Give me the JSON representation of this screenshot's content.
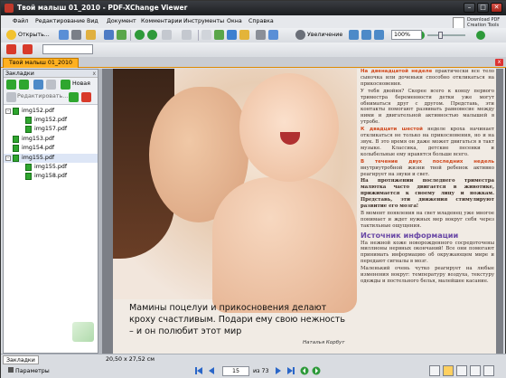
{
  "window": {
    "title": "Твой малыш 01_2010 - PDF-XChange Viewer"
  },
  "menu": [
    "Файл",
    "Редактирование",
    "Вид",
    "Документ",
    "Комментарии",
    "Инструменты",
    "Окна",
    "Справка"
  ],
  "download": {
    "line1": "Download PDF",
    "line2": "Creation Tools"
  },
  "toolbar": {
    "open_label": "Открыть...",
    "zoom_label": "Увеличение",
    "zoom_value": "100%"
  },
  "doc_tab": {
    "label": "Твой малыш 01_2010",
    "close": "x"
  },
  "sidebar": {
    "title": "Закладки",
    "close": "x",
    "new_label": "Новая",
    "edit_label": "Редактировать...",
    "bookmarks": [
      {
        "label": "img152.pdf",
        "level": 0,
        "exp": "-"
      },
      {
        "label": "img152.pdf",
        "level": 1
      },
      {
        "label": "img157.pdf",
        "level": 1
      },
      {
        "label": "img153.pdf",
        "level": 0
      },
      {
        "label": "img154.pdf",
        "level": 0
      },
      {
        "label": "img155.pdf",
        "level": 0,
        "exp": "-"
      },
      {
        "label": "img155.pdf",
        "level": 1
      },
      {
        "label": "img158.pdf",
        "level": 1
      }
    ]
  },
  "page": {
    "caption": "Мамины поцелуи и прикосновения делают кроху счастливым. Подари ему свою нежность – и он полюбит этот мир",
    "signature": "Наталья Корбут",
    "p1_hl": "На двенадцатой неделе",
    "p1": " практически все тело сыночка или доченьки способно откликаться на прикосновения.",
    "p2": "У тебя двойня? Скорее всего к концу первого триместра беременности детки уже могут обниматься друг с другом. Представь, эти контакты помогают развивать равновесие между ними и двигательной активностью малышей в утробе.",
    "p3_hl": "К двадцати шестой",
    "p3": " неделе кроха начинает откликаться не только на прикосновения, но и на звук. В это время он даже может двигаться в такт музыке. Классика, детские песенки и колыбельные ему нравятся больше всего.",
    "p4_hl": "В течение двух последних недель",
    "p4": " внутриутробной жизни твой ребенок активно реагирует на звуки и свет.",
    "p5_bold": "На протяжении последнего триместра малютка часто двигается в животике, прижимается к своему лицу и ножкам. Представь, эти движения стимулируют развитие его мозга!",
    "p6": "В момент появления на свет младенец уже многое понимает и ждет нужных мер вокруг себя через тактильные ощущения.",
    "section": "Источник информации",
    "p7": "На нежной коже новорожденного сосредоточены миллионы нервных окончаний! Все они помогают принимать информацию об окружающем мире и передают сигналы в мозг.",
    "p8": "Маленький очень чутко реагирует на любые изменения вокруг: температуру воздуха, текстуру одежды и постельного белья, малейшее касание."
  },
  "status": {
    "panel_tab": "Закладки",
    "page_size": "20,50 x 27,52 см",
    "params_label": "Параметры",
    "current_page": "15",
    "page_count": "из 73"
  }
}
